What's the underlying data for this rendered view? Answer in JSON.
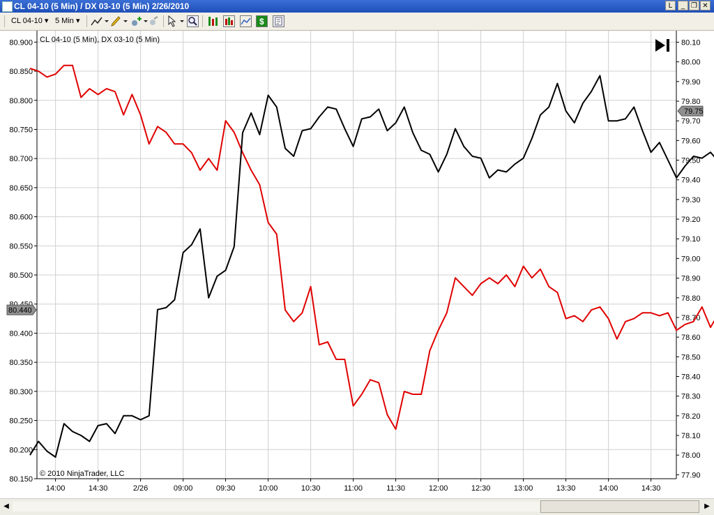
{
  "window": {
    "title": "CL 04-10 (5 Min) / DX 03-10 (5 Min)  2/26/2010",
    "buttons": [
      "L",
      "_",
      "❐",
      "✕"
    ]
  },
  "toolbar": {
    "instrument": "CL 04-10",
    "interval": "5 Min"
  },
  "chart_header": "CL 04-10 (5 Min), DX 03-10 (5 Min)",
  "copyright": "© 2010 NinjaTrader, LLC",
  "colors": {
    "cl_series": "#e00000",
    "dx_series": "#000000",
    "grid": "#d0d0d0"
  },
  "chart_data": {
    "type": "line",
    "x": [
      "13:50",
      "13:55",
      "14:00",
      "14:05",
      "14:10",
      "14:15",
      "14:20",
      "14:25",
      "14:30",
      "14:35",
      "14:40",
      "14:45",
      "14:50",
      "14:55",
      "15:00",
      "15:05",
      "15:10",
      "15:15",
      "9:00",
      "9:05",
      "9:10",
      "9:15",
      "9:20",
      "9:25",
      "9:30",
      "9:35",
      "9:40",
      "9:45",
      "9:50",
      "9:55",
      "10:00",
      "10:05",
      "10:10",
      "10:15",
      "10:20",
      "10:25",
      "10:30",
      "10:35",
      "10:40",
      "10:45",
      "10:50",
      "10:55",
      "11:00",
      "11:05",
      "11:10",
      "11:15",
      "11:20",
      "11:25",
      "11:30",
      "11:35",
      "11:40",
      "11:45",
      "11:50",
      "11:55",
      "12:00",
      "12:05",
      "12:10",
      "12:15",
      "12:20",
      "12:25",
      "12:30",
      "12:35",
      "12:40",
      "12:45",
      "12:50",
      "12:55",
      "13:00",
      "13:05",
      "13:10",
      "13:15",
      "13:20",
      "13:25",
      "13:30",
      "13:35",
      "13:40",
      "13:45",
      "13:50",
      "13:55",
      "14:00",
      "14:05",
      "14:10",
      "14:15",
      "14:20",
      "14:25",
      "14:30",
      "14:35",
      "14:40",
      "14:45"
    ],
    "xtick_labels": [
      "14:00",
      "14:30",
      "2/26",
      "09:00",
      "09:30",
      "10:00",
      "10:30",
      "11:00",
      "11:30",
      "12:00",
      "12:30",
      "13:00",
      "13:30",
      "14:00",
      "14:30"
    ],
    "xtick_index": [
      3,
      8,
      13,
      18,
      23,
      28,
      33,
      38,
      43,
      48,
      53,
      58,
      63,
      68,
      73
    ],
    "left_axis": {
      "label": "CL 04-10",
      "ylim": [
        80.15,
        80.91
      ],
      "ticks": [
        "80.900",
        "80.850",
        "80.800",
        "80.750",
        "80.700",
        "80.650",
        "80.600",
        "80.550",
        "80.500",
        "80.450",
        "80.400",
        "80.350",
        "80.300",
        "80.250",
        "80.200",
        "80.150"
      ],
      "last_value": "80.440"
    },
    "right_axis": {
      "label": "DX 03-10",
      "ylim": [
        77.88,
        80.13
      ],
      "ticks": [
        "80.10",
        "80.00",
        "79.90",
        "79.80",
        "79.70",
        "79.60",
        "79.50",
        "79.40",
        "79.30",
        "79.20",
        "79.10",
        "79.00",
        "78.90",
        "78.80",
        "78.70",
        "78.60",
        "78.50",
        "78.40",
        "78.30",
        "78.20",
        "78.10",
        "78.00",
        "77.90"
      ],
      "last_value": "79.75"
    },
    "series": [
      {
        "name": "CL 04-10 (5 Min)",
        "axis": "left",
        "values": [
          80.855,
          80.85,
          80.84,
          80.845,
          80.86,
          80.86,
          80.805,
          80.82,
          80.81,
          80.82,
          80.815,
          80.775,
          80.81,
          80.775,
          80.725,
          80.755,
          80.745,
          80.725,
          80.725,
          80.71,
          80.68,
          80.7,
          80.68,
          80.765,
          80.745,
          80.71,
          80.68,
          80.655,
          80.59,
          80.57,
          80.44,
          80.42,
          80.435,
          80.48,
          80.38,
          80.385,
          80.355,
          80.355,
          80.275,
          80.295,
          80.32,
          80.315,
          80.26,
          80.235,
          80.3,
          80.295,
          80.295,
          80.37,
          80.405,
          80.435,
          80.495,
          80.48,
          80.465,
          80.485,
          80.495,
          80.485,
          80.5,
          80.48,
          80.515,
          80.495,
          80.51,
          80.48,
          80.47,
          80.425,
          80.43,
          80.42,
          80.44,
          80.445,
          80.425,
          80.39,
          80.42,
          80.425,
          80.435,
          80.435,
          80.43,
          80.435,
          80.405,
          80.415,
          80.42,
          80.445,
          80.41,
          80.435,
          80.415,
          80.435,
          80.435,
          80.425,
          80.43,
          80.42,
          80.425,
          80.43,
          80.43,
          80.44
        ]
      },
      {
        "name": "DX 03-10 (5 Min)",
        "axis": "right",
        "values": [
          78.0,
          78.07,
          78.02,
          77.99,
          78.16,
          78.12,
          78.1,
          78.07,
          78.15,
          78.16,
          78.11,
          78.2,
          78.2,
          78.18,
          78.2,
          78.74,
          78.75,
          78.79,
          79.03,
          79.07,
          79.15,
          78.8,
          78.91,
          78.94,
          79.06,
          79.64,
          79.74,
          79.63,
          79.83,
          79.77,
          79.56,
          79.52,
          79.65,
          79.66,
          79.72,
          79.77,
          79.76,
          79.66,
          79.57,
          79.71,
          79.72,
          79.76,
          79.65,
          79.69,
          79.77,
          79.64,
          79.55,
          79.53,
          79.44,
          79.53,
          79.66,
          79.57,
          79.52,
          79.51,
          79.41,
          79.45,
          79.44,
          79.48,
          79.51,
          79.61,
          79.73,
          79.77,
          79.89,
          79.75,
          79.69,
          79.79,
          79.85,
          79.93,
          79.7,
          79.7,
          79.71,
          79.77,
          79.65,
          79.54,
          79.59,
          79.5,
          79.41,
          79.47,
          79.52,
          79.51,
          79.54,
          79.49,
          79.5,
          79.65,
          79.66,
          79.68,
          79.7,
          79.67,
          79.71,
          79.73,
          79.69,
          79.74,
          79.75
        ]
      }
    ]
  }
}
